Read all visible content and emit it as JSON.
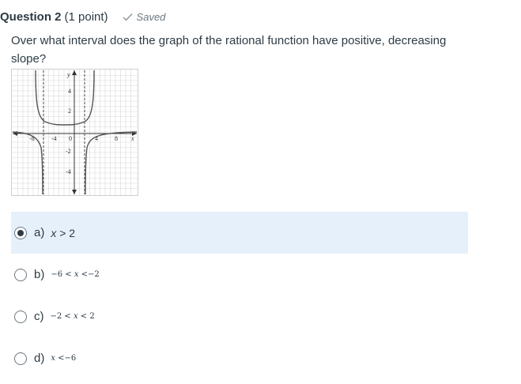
{
  "question": {
    "title": "Question 2",
    "points": "(1 point)",
    "status": "Saved",
    "status_icon": "check-icon",
    "text": "Over what interval does the graph of the rational function have positive, decreasing slope?"
  },
  "graph": {
    "y_axis_label": "y",
    "x_axis_label": "x",
    "x_tick_labels": [
      "-8",
      "-4",
      "0",
      "4",
      "8"
    ],
    "y_tick_labels": [
      "4",
      "2",
      "-2",
      "-4"
    ]
  },
  "answers": [
    {
      "letter": "a)",
      "pre": "",
      "var": "x",
      "post": " > 2",
      "selected": true
    },
    {
      "letter": "b)",
      "pre": "−6 < ",
      "var": "x",
      "post": " <−2",
      "selected": false
    },
    {
      "letter": "c)",
      "pre": "−2 < ",
      "var": "x",
      "post": " < 2",
      "selected": false
    },
    {
      "letter": "d)",
      "pre": "",
      "var": "x",
      "post": " <−6",
      "selected": false
    }
  ],
  "colors": {
    "selected_bg": "#e5f0fb",
    "text": "#2d3b45",
    "muted": "#6b7780"
  }
}
